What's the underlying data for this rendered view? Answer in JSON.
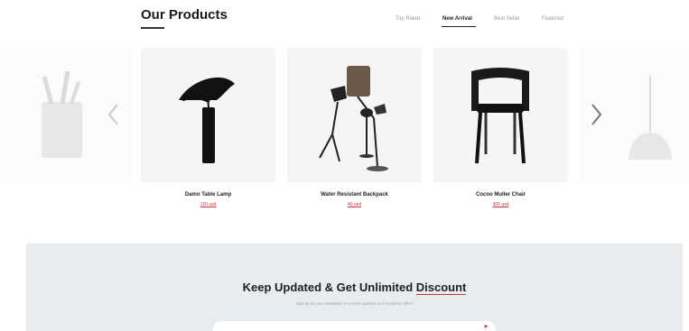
{
  "section": {
    "title": "Our Products"
  },
  "tabs": [
    {
      "label": "Top Rated",
      "active": false
    },
    {
      "label": "New Arrival",
      "active": true
    },
    {
      "label": "Best Seller",
      "active": false
    },
    {
      "label": "Featured",
      "active": false
    }
  ],
  "products": [
    {
      "name": "Damo Table Lamp",
      "price": "120 usd",
      "icon": "table-lamp"
    },
    {
      "name": "Water Resistant Backpack",
      "price": "40 usd",
      "icon": "floor-lamp-set"
    },
    {
      "name": "Cocoo Muller Chair",
      "price": "300 usd",
      "icon": "chair"
    }
  ],
  "peek_items": [
    {
      "icon": "pencil-cup"
    },
    {
      "icon": "pendant-lamp"
    }
  ],
  "carousel": {
    "prev_icon": "chevron-left-icon",
    "next_icon": "chevron-right-icon"
  },
  "newsletter": {
    "title_main": "Keep Updated & Get Unlimited ",
    "title_accent": "Discount",
    "subtitle": "Sign up for our newsletter to receive updates and exclusive offers",
    "send_icon": "send-icon"
  },
  "colors": {
    "accent": "#c0392b",
    "card_bg": "#f5f5f5",
    "newsletter_bg": "#e6ecef"
  }
}
